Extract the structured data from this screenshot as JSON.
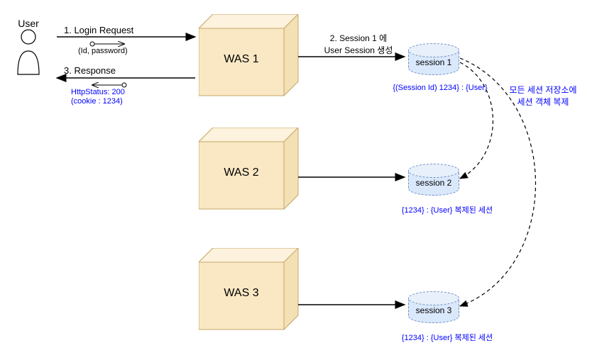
{
  "user_label": "User",
  "was_boxes": [
    "WAS 1",
    "WAS 2",
    "WAS 3"
  ],
  "sessions": [
    "session 1",
    "session 2",
    "session 3"
  ],
  "arrows": {
    "login_request": "1. Login Request",
    "login_request_sub": "(Id, password)",
    "response": "3. Response",
    "response_sub1": "HttpStatus: 200",
    "response_sub2": "(cookie : 1234)",
    "session_create_line1": "2.  Session 1 에",
    "session_create_line2": "User Session 생성"
  },
  "session_data": {
    "session1_label": "{(Session Id) 1234} : {User}",
    "session2_label": "{1234} : {User}  복제된 세션",
    "session3_label": "{1234} : {User}  복제된 세션"
  },
  "replication_note_line1": "모든 세션 저장소에",
  "replication_note_line2": "세션 객체 복제"
}
